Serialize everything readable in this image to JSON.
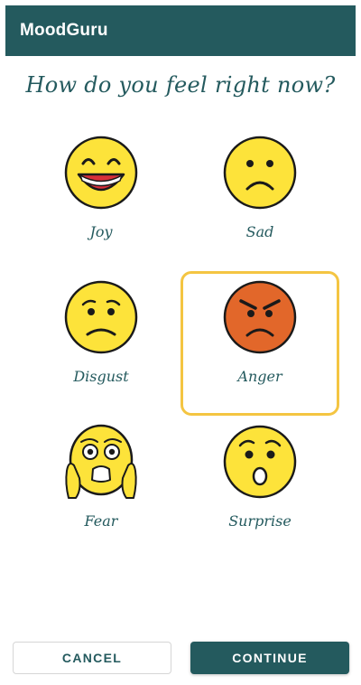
{
  "app": {
    "title": "MoodGuru",
    "bar_color": "#245a5e"
  },
  "question": "How do you feel right now?",
  "moods": [
    {
      "label": "Joy",
      "icon": "grinning-face-icon",
      "selected": false
    },
    {
      "label": "Sad",
      "icon": "frowning-face-icon",
      "selected": false
    },
    {
      "label": "Disgust",
      "icon": "worried-face-icon",
      "selected": false
    },
    {
      "label": "Anger",
      "icon": "angry-face-icon",
      "selected": true
    },
    {
      "label": "Fear",
      "icon": "screaming-face-icon",
      "selected": false
    },
    {
      "label": "Surprise",
      "icon": "surprised-face-icon",
      "selected": false
    }
  ],
  "buttons": {
    "cancel": "CANCEL",
    "continue": "CONTINUE"
  },
  "colors": {
    "primary": "#245a5e",
    "selection": "#f4c542",
    "face_yellow": "#fde33a",
    "face_anger": "#e2672a"
  }
}
